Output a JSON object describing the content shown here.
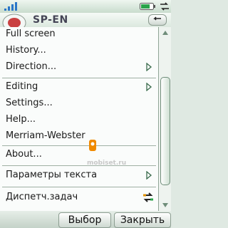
{
  "app": {
    "title": "SP-EN"
  },
  "menu": {
    "items": [
      {
        "label": "Full screen"
      },
      {
        "label": "History..."
      },
      {
        "label": "Direction...",
        "submenu": true
      },
      {
        "label": "Editing",
        "submenu": true
      },
      {
        "label": "Settings..."
      },
      {
        "label": "Help..."
      },
      {
        "label": "Merriam-Webster"
      },
      {
        "label": "About..."
      },
      {
        "label": "Параметры текста",
        "submenu": true
      },
      {
        "label": "Диспетч.задач"
      }
    ]
  },
  "softkeys": {
    "left": "Выбор",
    "right": "Закрыть"
  },
  "watermark": {
    "text": "mobiset.ru"
  },
  "colors": {
    "accent": "#f08a00",
    "status_green": "#2aa34a",
    "network_blue": "#2a76c8"
  },
  "icons": {
    "signal": "signal-icon",
    "battery": "battery-icon",
    "connection": "connection-icon",
    "back": "back-icon",
    "submenu": "chevron-right-icon"
  }
}
